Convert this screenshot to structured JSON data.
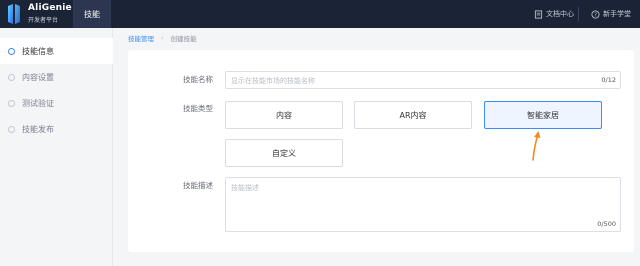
{
  "brand": {
    "name": "AliGenie",
    "subtitle": "开发者平台"
  },
  "topnav": {
    "active_tab": "技能",
    "docs_label": "文档中心",
    "help_label": "新手学堂"
  },
  "sidebar": {
    "items": [
      {
        "label": "技能信息",
        "active": true
      },
      {
        "label": "内容设置",
        "active": false
      },
      {
        "label": "测试验证",
        "active": false
      },
      {
        "label": "技能发布",
        "active": false
      }
    ]
  },
  "breadcrumb": {
    "parent": "技能管理",
    "current": "创建技能"
  },
  "form": {
    "name_label": "技能名称",
    "name_placeholder": "显示在技能市场的技能名称",
    "name_counter": "0/12",
    "type_label": "技能类型",
    "types": [
      "内容",
      "AR内容",
      "智能家居",
      "自定义"
    ],
    "selected_type": "智能家居",
    "desc_label": "技能描述",
    "desc_placeholder": "技能描述",
    "desc_counter": "0/500"
  },
  "colors": {
    "topbar": "#1b2336",
    "accent": "#3e8bf4",
    "arrow": "#f08a24"
  }
}
